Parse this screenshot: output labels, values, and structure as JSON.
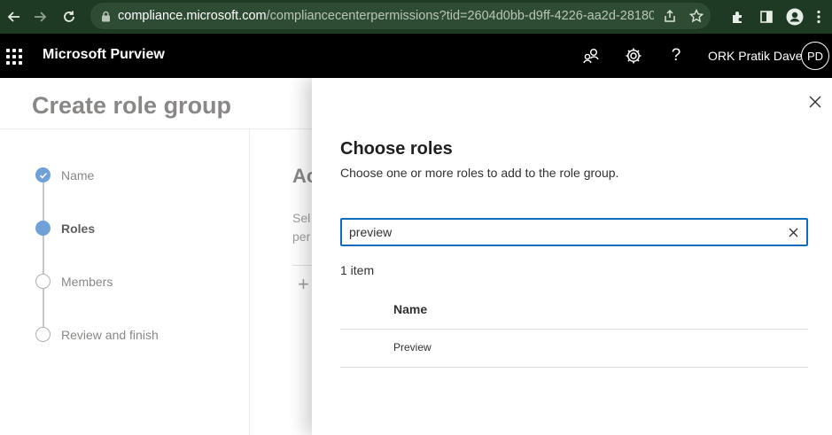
{
  "browser": {
    "url_host": "compliance.microsoft.com",
    "url_rest": "/compliancecenterpermissions?tid=2604d0bb-d9ff-4226-aa2d-28180..."
  },
  "appbar": {
    "title": "Microsoft Purview",
    "user_name": "ORK Pratik Dave",
    "avatar_initials": "PD",
    "help_glyph": "?"
  },
  "page": {
    "title": "Create role group",
    "bg_heading": "Ac",
    "bg_desc_line1": "Sel",
    "bg_desc_line2": "per",
    "bg_plus": "+"
  },
  "steps": [
    {
      "label": "Name",
      "state": "done"
    },
    {
      "label": "Roles",
      "state": "current"
    },
    {
      "label": "Members",
      "state": "pending"
    },
    {
      "label": "Review and finish",
      "state": "pending"
    }
  ],
  "panel": {
    "title": "Choose roles",
    "subtitle": "Choose one or more roles to add to the role group.",
    "search_value": "preview",
    "count": "1 item",
    "column_header": "Name",
    "rows": [
      {
        "name": "Preview"
      }
    ]
  },
  "colors": {
    "accent": "#0f6cbd",
    "step_active": "#6fa0d8",
    "chrome_bg": "#1f3a24",
    "appbar_bg": "#000000"
  }
}
